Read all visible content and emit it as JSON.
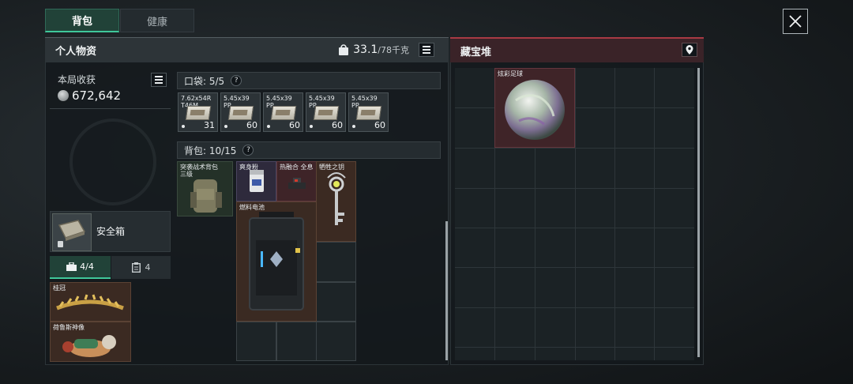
{
  "tabs": [
    {
      "label": "背包"
    },
    {
      "label": "健康"
    }
  ],
  "personal": {
    "title": "个人物资",
    "weight_current": "33.1",
    "weight_max": "/78千克"
  },
  "earnings": {
    "label": "本局收获",
    "value": "672,642"
  },
  "safe_box": {
    "label": "安全箱"
  },
  "subtabs": [
    {
      "label": "4/4",
      "icon": "toolbox-icon"
    },
    {
      "label": "4",
      "icon": "clipboard-icon"
    }
  ],
  "safe_items": [
    {
      "name": "桂冠"
    },
    {
      "name": "荷鲁斯神像"
    }
  ],
  "pocket": {
    "label": "口袋: 5/5",
    "help": "?",
    "items": [
      {
        "name": "7.62x54R",
        "sub": "T46M",
        "count": "31"
      },
      {
        "name": "5.45x39",
        "sub": "PP",
        "count": "60"
      },
      {
        "name": "5.45x39",
        "sub": "PP",
        "count": "60"
      },
      {
        "name": "5.45x39",
        "sub": "PP",
        "count": "60"
      },
      {
        "name": "5.45x39",
        "sub": "PP",
        "count": "60"
      }
    ]
  },
  "backpack": {
    "label": "背包: 10/15",
    "help": "?",
    "equipped": {
      "name": "突袭战术背包",
      "sub": "三级"
    },
    "items": [
      {
        "name": "爽身粉"
      },
      {
        "name": "热融合 全息"
      },
      {
        "name": "牺牲之钥"
      },
      {
        "name": "燃料电池"
      }
    ]
  },
  "treasure": {
    "title": "藏宝堆",
    "items": [
      {
        "name": "炫彩足球"
      }
    ]
  },
  "colors": {
    "accent_green": "#3fc79a",
    "accent_red": "#a83a44",
    "panel_bg": "#14191c"
  }
}
